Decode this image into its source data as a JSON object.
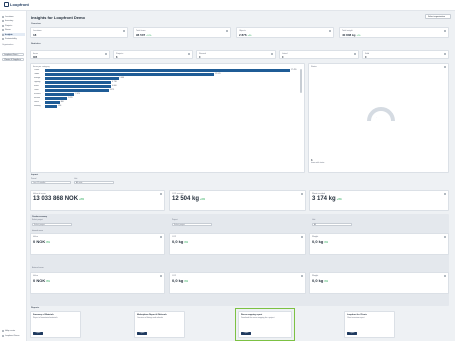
{
  "app": {
    "logo": "Loopfront"
  },
  "sidebar": {
    "items": [
      {
        "label": "Locations"
      },
      {
        "label": "Inventory"
      },
      {
        "label": "Projects"
      },
      {
        "label": "Reuse"
      },
      {
        "label": "Insights"
      },
      {
        "label": "Sustainability"
      }
    ],
    "section_label": "Organization",
    "org_select": "Loopfront Dem...",
    "view_select": "Clients & Suppliers",
    "bottom_items": [
      {
        "label": "Help center"
      },
      {
        "label": "Loopfront Demo"
      }
    ]
  },
  "header": {
    "title": "Insights for Loopfront Demo",
    "selector": "Select organization"
  },
  "summary": {
    "label": "Overview",
    "cards": [
      {
        "title": "Locations",
        "value": "18"
      },
      {
        "title": "Total items",
        "value": "96 507",
        "delta": "+12%"
      },
      {
        "title": "Objects",
        "value": "2 876",
        "delta": "+4%"
      },
      {
        "title": "Total weight",
        "value": "40 808 kg",
        "delta": "+2%"
      }
    ]
  },
  "stock": {
    "label": "Statistics",
    "cards": [
      {
        "title": "Items",
        "value": "305"
      },
      {
        "title": "Projects",
        "value": "8"
      },
      {
        "title": "Reused",
        "value": "0"
      },
      {
        "title": "Listed",
        "value": "0"
      },
      {
        "title": "Sold",
        "value": "0"
      }
    ]
  },
  "categories": {
    "title": "Items per category",
    "rows": [
      {
        "label": "Chairs",
        "value": "17 455",
        "pct": 1.0
      },
      {
        "label": "Tables",
        "value": "12 070",
        "pct": 0.69
      },
      {
        "label": "Storage",
        "value": "5 066",
        "pct": 0.3
      },
      {
        "label": "Lighting",
        "value": "4 716",
        "pct": 0.27
      },
      {
        "label": "Sofas",
        "value": "4 600",
        "pct": 0.27
      },
      {
        "label": "Other",
        "value": "4 579",
        "pct": 0.26
      },
      {
        "label": "Screens",
        "value": "2 070",
        "pct": 0.12
      },
      {
        "label": "Kitchen",
        "value": "1 615",
        "pct": 0.09
      },
      {
        "label": "Doors",
        "value": "866",
        "pct": 0.06
      },
      {
        "label": "Flooring",
        "value": "656",
        "pct": 0.05
      }
    ]
  },
  "side_panel": {
    "title": "Status",
    "count": "1",
    "caption": "items with status"
  },
  "impact": {
    "label": "Impact",
    "filter_label": "Period",
    "filter_value": "Last 12 months",
    "unit_label": "Unit",
    "unit_value": "All units",
    "cards": [
      {
        "title": "Value of reuse",
        "value": "13 033 868 NOK",
        "delta": "+8%"
      },
      {
        "title": "CO2 savings",
        "value": "12 504 kg",
        "delta": "+6%"
      },
      {
        "title": "Waste avoided",
        "value": "3 174 kg",
        "delta": "+3%"
      }
    ]
  },
  "circular": {
    "label": "Circular economy",
    "sub_label": "Select project",
    "input_placeholder": "Select project",
    "mid_label": "Project",
    "mid_placeholder": "Select project",
    "right_label": "Unit",
    "right_value": "All",
    "row_label": "Internal reuse",
    "cards": [
      {
        "title": "Value",
        "value": "0 NOK",
        "delta": "0%"
      },
      {
        "title": "CO2",
        "value": "0,0 kg",
        "delta": "0%"
      },
      {
        "title": "Weight",
        "value": "0,0 kg",
        "delta": "0%"
      }
    ],
    "row2_label": "External reuse",
    "cards2": [
      {
        "title": "Value",
        "value": "0 NOK",
        "delta": "0%"
      },
      {
        "title": "CO2",
        "value": "0,0 kg",
        "delta": "0%"
      },
      {
        "title": "Weight",
        "value": "0,0 kg",
        "delta": "0%"
      }
    ]
  },
  "reports": {
    "label": "Reports",
    "items": [
      {
        "title": "Summary of Materials",
        "desc": "Report of inventoried materials",
        "button": "Open"
      },
      {
        "title": "Marketplace Report & Referrals",
        "desc": "Overview of listings and referrals",
        "button": "Open"
      },
      {
        "title": "Reuse mapping report",
        "desc": "Download the reuse mapping for a project",
        "button": "Open"
      },
      {
        "title": "Loopfront for Clients",
        "desc": "Client overview report",
        "button": "Open"
      }
    ]
  },
  "colors": {
    "accent": "#1f5c96",
    "highlight": "#7cc143",
    "positive": "#16a34a"
  }
}
